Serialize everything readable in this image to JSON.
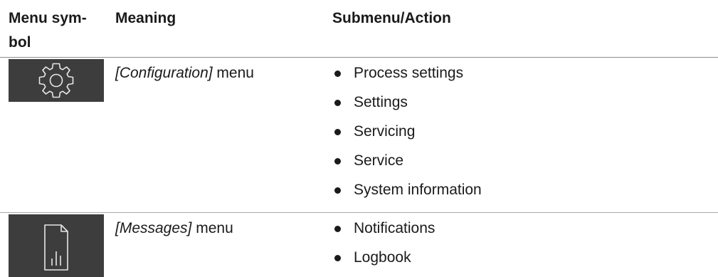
{
  "header": {
    "col_symbol": "Menu sym-\nbol",
    "col_symbol_line1": "Menu sym-",
    "col_symbol_line2": "bol",
    "col_meaning": "Meaning",
    "col_action": "Submenu/Action"
  },
  "rows": [
    {
      "icon": "gear-icon",
      "menu_name": "[Configuration]",
      "menu_suffix": " menu",
      "actions": [
        "Process settings",
        "Settings",
        "Servicing",
        "Service",
        "System information"
      ]
    },
    {
      "icon": "document-chart-icon",
      "menu_name": "[Messages]",
      "menu_suffix": " menu",
      "actions": [
        "Notifications",
        "Logbook"
      ]
    }
  ],
  "colors": {
    "icon_background": "#3d3d3d",
    "icon_stroke": "#e6e6e6",
    "text": "#1a1a1a"
  }
}
